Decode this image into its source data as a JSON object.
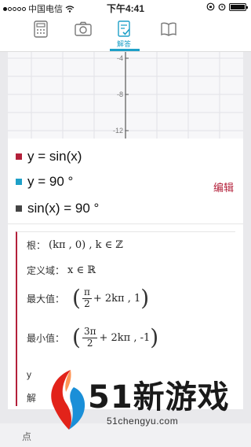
{
  "status": {
    "carrier": "中国电信",
    "time": "下午4:41"
  },
  "toolbar": {
    "items": [
      {
        "name": "calculator-icon"
      },
      {
        "name": "camera-icon"
      },
      {
        "name": "answer-icon",
        "label": "解答"
      },
      {
        "name": "book-icon"
      }
    ]
  },
  "graph": {
    "y_ticks": [
      "-4",
      "-8",
      "-12"
    ]
  },
  "equations": [
    {
      "text": "y = sin(x)",
      "color": "#b3203a"
    },
    {
      "text": "y = 90 °",
      "color": "#1ea0c8"
    },
    {
      "text": "sin(x) = 90 °",
      "color": "#444444"
    }
  ],
  "edit_label": "编辑",
  "properties": {
    "roots_label": "根：",
    "roots_value": "(kπ , 0) , k ∈ ℤ",
    "domain_label": "定义域：",
    "domain_value": "x ∈ ℝ",
    "max_label": "最大值：",
    "max_frac_num": "π",
    "max_frac_den": "2",
    "max_rest": "+ 2kπ , 1",
    "min_label": "最小值：",
    "min_frac_num": "3π",
    "min_frac_den": "2",
    "min_rest": "+ 2kπ , -1",
    "partial_y": "y",
    "partial_jie": "解"
  },
  "bottom": {
    "dian": "点"
  },
  "watermark": {
    "brand": "51新游戏",
    "url": "51chengyu.com"
  }
}
